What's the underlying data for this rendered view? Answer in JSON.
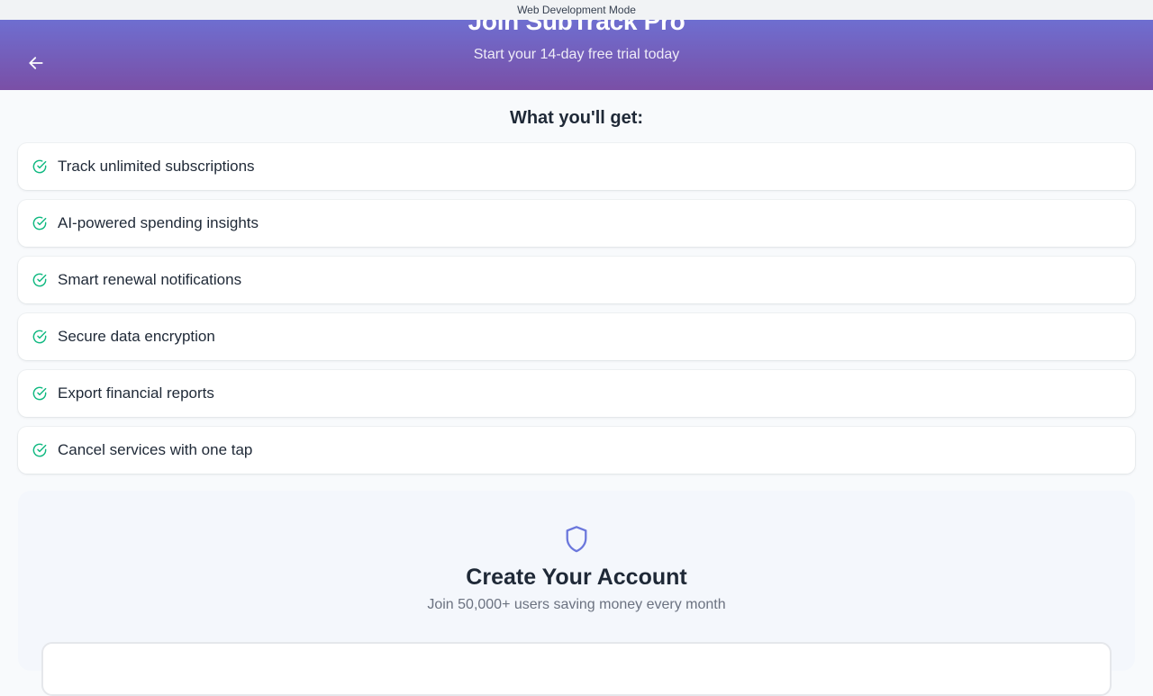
{
  "dev_banner": "Web Development Mode",
  "header": {
    "title": "Join SubTrack Pro",
    "subtitle": "Start your 14-day free trial today",
    "back_icon": "arrow-left-icon"
  },
  "features": {
    "heading": "What you'll get:",
    "icon": "check-circle-icon",
    "items": [
      {
        "label": "Track unlimited subscriptions"
      },
      {
        "label": "AI-powered spending insights"
      },
      {
        "label": "Smart renewal notifications"
      },
      {
        "label": "Secure data encryption"
      },
      {
        "label": "Export financial reports"
      },
      {
        "label": "Cancel services with one tap"
      }
    ]
  },
  "account": {
    "icon": "shield-icon",
    "title": "Create Your Account",
    "subtitle": "Join 50,000+ users saving money every month"
  },
  "colors": {
    "gradient_top": "#6b77dc",
    "gradient_bottom": "#7a4fa6",
    "check_green": "#10b981",
    "shield_blue": "#6b77dc"
  }
}
